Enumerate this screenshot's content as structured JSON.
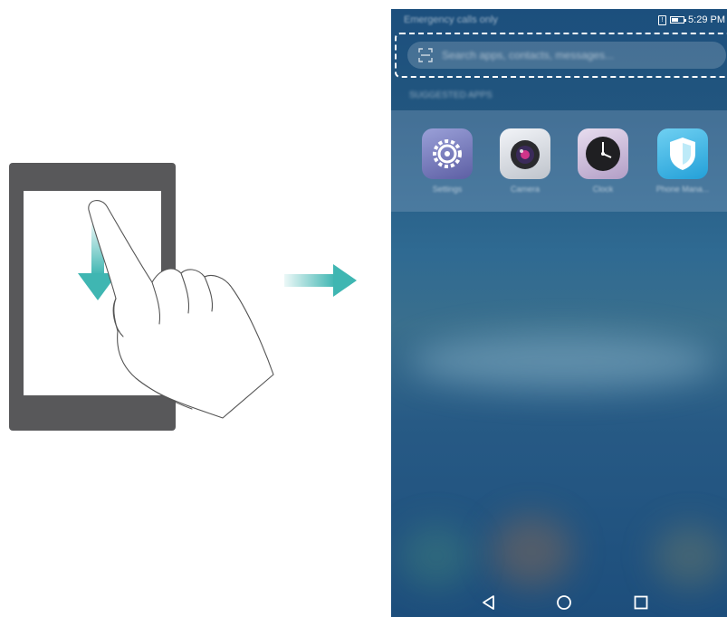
{
  "phone": {
    "status_bar": {
      "left_text": "Emergency calls only",
      "time": "5:29 PM"
    },
    "search": {
      "placeholder": "Search apps, contacts, messages..."
    },
    "suggested_label": "SUGGESTED APPS",
    "apps": [
      {
        "label": "Settings",
        "icon": "settings-gear-icon"
      },
      {
        "label": "Camera",
        "icon": "camera-icon"
      },
      {
        "label": "Clock",
        "icon": "clock-icon"
      },
      {
        "label": "Phone Mana...",
        "icon": "shield-icon"
      }
    ],
    "nav": [
      "back-icon",
      "home-icon",
      "recents-icon"
    ]
  },
  "colors": {
    "accent_teal": "#3fb6b2",
    "tablet_frame": "#58585a"
  }
}
